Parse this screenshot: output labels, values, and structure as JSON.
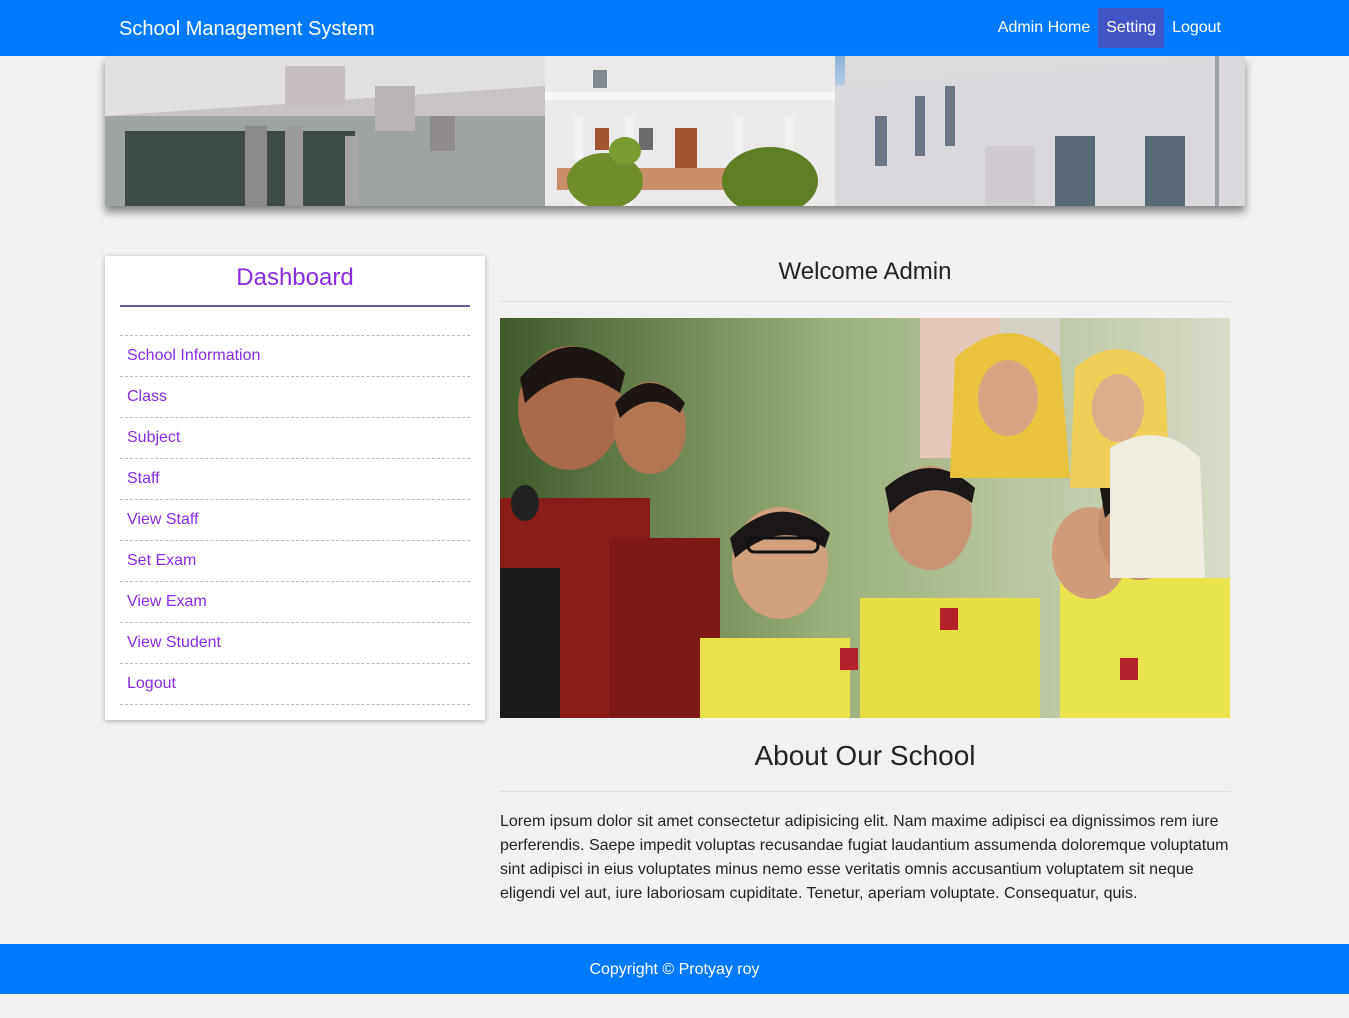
{
  "navbar": {
    "brand": "School Management System",
    "links": [
      {
        "label": "Admin Home"
      },
      {
        "label": "Setting"
      },
      {
        "label": "Logout"
      }
    ],
    "color": "#007bff",
    "active_color": "#4054c4"
  },
  "sidebar": {
    "title": "Dashboard",
    "items": [
      {
        "label": "School Information"
      },
      {
        "label": "Class"
      },
      {
        "label": "Subject"
      },
      {
        "label": "Staff"
      },
      {
        "label": "View Staff"
      },
      {
        "label": "Set Exam"
      },
      {
        "label": "View Exam"
      },
      {
        "label": "View Student"
      },
      {
        "label": "Logout"
      }
    ],
    "accent_color": "#8a2be2"
  },
  "main": {
    "welcome": "Welcome Admin",
    "about_title": "About Our School",
    "about_text": "Lorem ipsum dolor sit amet consectetur adipisicing elit. Nam maxime adipisci ea dignissimos rem iure perferendis. Saepe impedit voluptas recusandae fugiat laudantium assumenda doloremque voluptatum sint adipisci in eius voluptates minus nemo esse veritatis omnis accusantium voluptatem sit neque eligendi vel aut, iure laboriosam cupiditate. Tenetur, aperiam voluptate. Consequatur, quis."
  },
  "footer": {
    "text": "Copyright © Protyay roy"
  }
}
